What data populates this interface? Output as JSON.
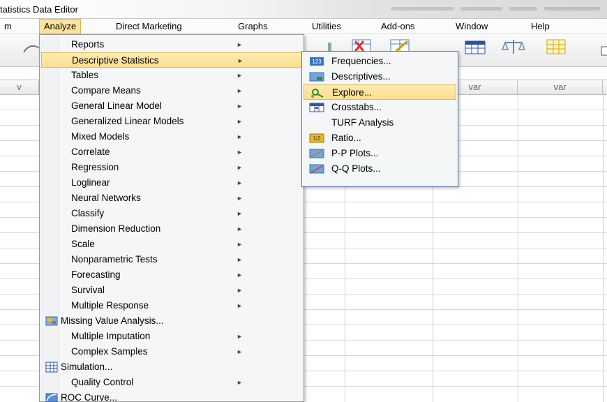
{
  "window": {
    "title": "tatistics Data Editor"
  },
  "menubar": {
    "items": [
      {
        "label": "m"
      },
      {
        "label": "Analyze"
      },
      {
        "label": "Direct Marketing"
      },
      {
        "label": "Graphs"
      },
      {
        "label": "Utilities"
      },
      {
        "label": "Add-ons"
      },
      {
        "label": "Window"
      },
      {
        "label": "Help"
      }
    ]
  },
  "grid": {
    "column_headers": [
      "v",
      "var",
      "var"
    ]
  },
  "analyze_menu": {
    "items": [
      {
        "label": "Reports",
        "submenu": true
      },
      {
        "label": "Descriptive Statistics",
        "submenu": true,
        "highlighted": true
      },
      {
        "label": "Tables",
        "submenu": true
      },
      {
        "label": "Compare Means",
        "submenu": true
      },
      {
        "label": "General Linear Model",
        "submenu": true
      },
      {
        "label": "Generalized Linear Models",
        "submenu": true
      },
      {
        "label": "Mixed Models",
        "submenu": true
      },
      {
        "label": "Correlate",
        "submenu": true
      },
      {
        "label": "Regression",
        "submenu": true
      },
      {
        "label": "Loglinear",
        "submenu": true
      },
      {
        "label": "Neural Networks",
        "submenu": true
      },
      {
        "label": "Classify",
        "submenu": true
      },
      {
        "label": "Dimension Reduction",
        "submenu": true
      },
      {
        "label": "Scale",
        "submenu": true
      },
      {
        "label": "Nonparametric Tests",
        "submenu": true
      },
      {
        "label": "Forecasting",
        "submenu": true
      },
      {
        "label": "Survival",
        "submenu": true
      },
      {
        "label": "Multiple Response",
        "submenu": true
      },
      {
        "label": "Missing Value Analysis...",
        "icon": "missing-value-icon"
      },
      {
        "label": "Multiple Imputation",
        "submenu": true
      },
      {
        "label": "Complex Samples",
        "submenu": true
      },
      {
        "label": "Simulation...",
        "icon": "simulation-icon"
      },
      {
        "label": "Quality Control",
        "submenu": true
      },
      {
        "label": "ROC Curve...",
        "icon": "roc-curve-icon"
      }
    ]
  },
  "descriptive_submenu": {
    "items": [
      {
        "label": "Frequencies...",
        "icon": "frequencies-icon"
      },
      {
        "label": "Descriptives...",
        "icon": "descriptives-icon"
      },
      {
        "label": "Explore...",
        "icon": "explore-icon",
        "highlighted": true
      },
      {
        "label": "Crosstabs...",
        "icon": "crosstabs-icon"
      },
      {
        "label": "TURF Analysis"
      },
      {
        "label": "Ratio...",
        "icon": "ratio-icon"
      },
      {
        "label": "P-P Plots...",
        "icon": "pp-plots-icon"
      },
      {
        "label": "Q-Q Plots...",
        "icon": "qq-plots-icon"
      }
    ]
  },
  "colors": {
    "highlight_fill": "#fde39a",
    "highlight_border": "#e5b84e",
    "submenu_border": "#5b7fb4"
  }
}
